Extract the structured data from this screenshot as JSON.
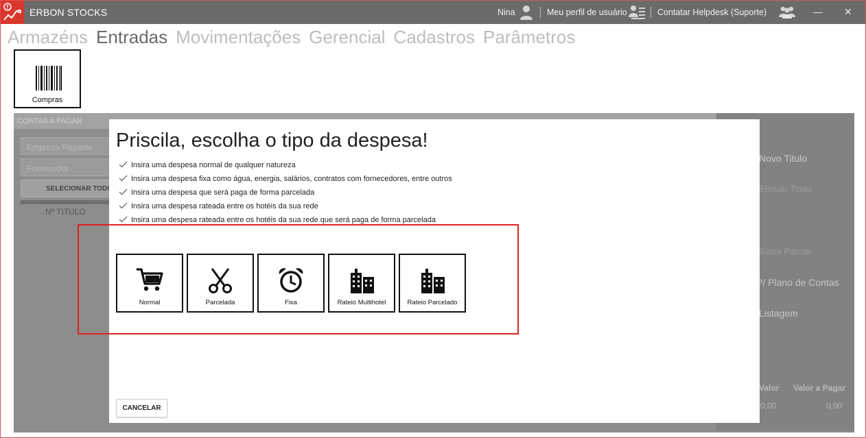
{
  "titlebar": {
    "app_title": "ERBON STOCKS",
    "user_name": "Nina",
    "profile_label": "Meu perfil de usuário",
    "helpdesk_label": "Contatar Helpdesk (Suporte)",
    "minimize_glyph": "—",
    "close_glyph": "✕"
  },
  "nav": {
    "items": [
      "Armazéns",
      "Entradas",
      "Movimentações",
      "Gerencial",
      "Cadastros",
      "Parâmetros"
    ],
    "active": "Entradas"
  },
  "submenu": {
    "compras_label": "Compras"
  },
  "background_panel": {
    "title": "CONTAS A PAGAR",
    "empresa_placeholder": "Empresa Pagante",
    "fornecedor_placeholder": "Fornecedor",
    "select_all_label": "SELECIONAR TODOS",
    "col_titulo": "Nº TITULO",
    "right_items": [
      "Novo Titulo",
      "Efetuar Titulo",
      "Baixa Parcial",
      "P/ Plano de Contas",
      "Listagem"
    ],
    "col_valor": "Valor",
    "col_valor_pagar": "Valor a Pagar",
    "valor": "0,00",
    "valor_pagar": "0,00"
  },
  "modal": {
    "title": "Priscila, escolha o tipo da despesa!",
    "bullets": [
      "Insira uma despesa normal de qualquer natureza",
      "Insira uma despesa fixa como água, energia, salários, contratos com fornecedores, entre outros",
      "Insira uma despesa que será paga de forma parcelada",
      "Insira uma despesa rateada entre os hotéis da sua rede",
      "Insira uma despesa rateada entre os hotéis da sua rede que será paga de forma parcelada"
    ],
    "options": [
      {
        "label": "Normal",
        "icon": "cart-icon"
      },
      {
        "label": "Parcelada",
        "icon": "scissors-icon"
      },
      {
        "label": "Fixa",
        "icon": "alarm-clock-icon"
      },
      {
        "label": "Rateio Multihotel",
        "icon": "buildings-icon"
      },
      {
        "label": "Rateio Parcelado",
        "icon": "buildings-icon"
      }
    ],
    "cancel_label": "CANCELAR"
  },
  "colors": {
    "titlebar": "#6b6b6b",
    "logo": "#d9362c",
    "highlight": "#e02020",
    "nav_active": "#6a6a6a",
    "nav_inactive": "#bdbdbd"
  }
}
